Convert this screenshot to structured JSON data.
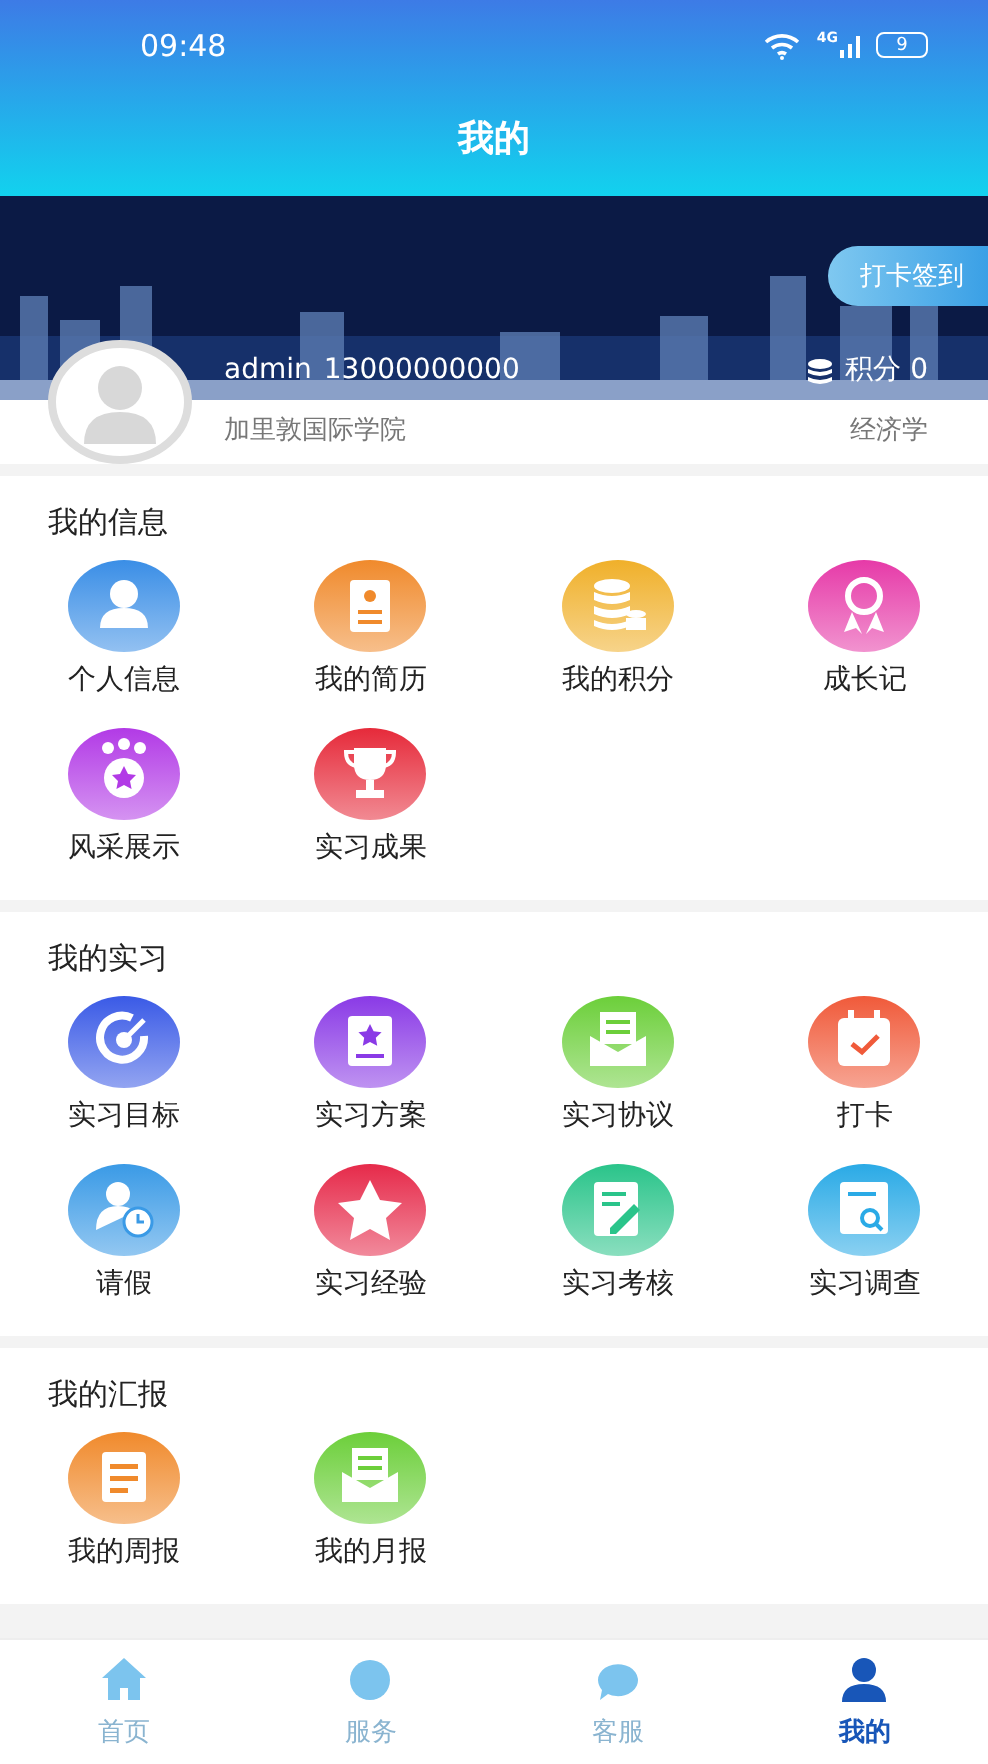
{
  "status_bar": {
    "time": "09:48",
    "network": "4G",
    "battery": "9"
  },
  "header": {
    "title": "我的"
  },
  "profile": {
    "checkin_button": "打卡签到",
    "name": "admin",
    "phone": "13000000000",
    "points": "积分 0",
    "school": "加里敦国际学院",
    "major": "经济学"
  },
  "sections": [
    {
      "title": "我的信息",
      "items": [
        {
          "label": "个人信息",
          "kind": "person",
          "color": "#3a8ee6"
        },
        {
          "label": "我的简历",
          "kind": "resume",
          "color": "#f08a2c"
        },
        {
          "label": "我的积分",
          "kind": "coins",
          "color": "#f0b02a"
        },
        {
          "label": "成长记",
          "kind": "medal",
          "color": "#e63aa8"
        },
        {
          "label": "风采展示",
          "kind": "badge",
          "color": "#b23ae6"
        },
        {
          "label": "实习成果",
          "kind": "trophy",
          "color": "#e62a3a"
        }
      ]
    },
    {
      "title": "我的实习",
      "items": [
        {
          "label": "实习目标",
          "kind": "target",
          "color": "#3a5ae6"
        },
        {
          "label": "实习方案",
          "kind": "plan",
          "color": "#8a3ae6"
        },
        {
          "label": "实习协议",
          "kind": "envelope",
          "color": "#6ccf3a"
        },
        {
          "label": "打卡",
          "kind": "calendar",
          "color": "#f05a3a"
        },
        {
          "label": "请假",
          "kind": "leave",
          "color": "#3a9ae6"
        },
        {
          "label": "实习经验",
          "kind": "star",
          "color": "#e62a4a"
        },
        {
          "label": "实习考核",
          "kind": "edit",
          "color": "#2ac48a"
        },
        {
          "label": "实习调查",
          "kind": "survey",
          "color": "#2aaae6"
        }
      ]
    },
    {
      "title": "我的汇报",
      "items": [
        {
          "label": "我的周报",
          "kind": "document",
          "color": "#f08a2c"
        },
        {
          "label": "我的月报",
          "kind": "envelope",
          "color": "#6ccf3a"
        }
      ]
    }
  ],
  "tabs": [
    {
      "label": "首页",
      "kind": "home",
      "selected": false
    },
    {
      "label": "服务",
      "kind": "grid",
      "selected": false
    },
    {
      "label": "客服",
      "kind": "chat",
      "selected": false
    },
    {
      "label": "我的",
      "kind": "user",
      "selected": true
    }
  ]
}
